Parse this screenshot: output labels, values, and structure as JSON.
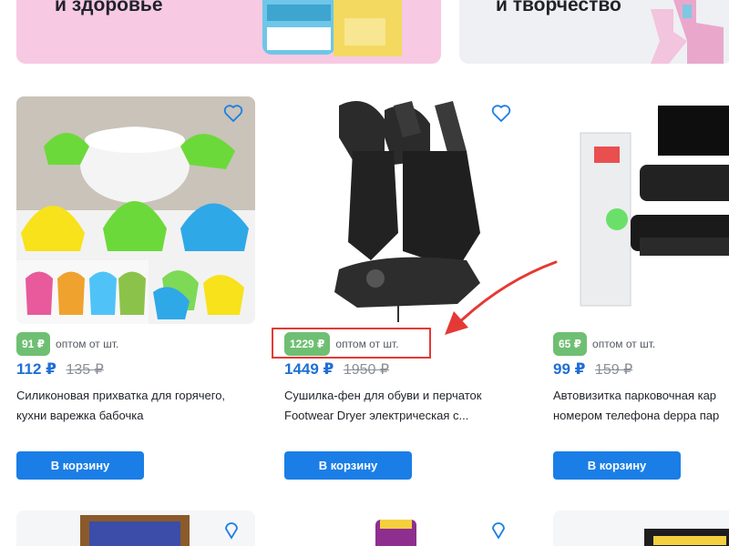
{
  "banners": [
    {
      "title": "и здоровье"
    },
    {
      "title": "и творчество"
    }
  ],
  "products": [
    {
      "opt_badge": "91 ₽",
      "opt_text": "оптом от шт.",
      "price": "112 ₽",
      "old_price": "135 ₽",
      "title": "Силиконовая прихватка для горячего, кухни варежка бабочка",
      "cart_label": "В корзину"
    },
    {
      "opt_badge": "1229 ₽",
      "opt_text": "оптом от шт.",
      "price": "1449 ₽",
      "old_price": "1950 ₽",
      "title": "Сушилка-фен для обуви и перчаток Footwear Dryer электрическая с...",
      "cart_label": "В корзину"
    },
    {
      "opt_badge": "65 ₽",
      "opt_text": "оптом от шт.",
      "price": "99 ₽",
      "old_price": "159 ₽",
      "title": "Автовизитка парковочная кар",
      "title_line2": "номером телефона deppa пар",
      "cart_label": "В корзину"
    }
  ],
  "colors": {
    "price": "#1f6fd6",
    "opt_badge": "#6fbf73",
    "cart_button": "#1a7ee6",
    "annotation": "#e53935"
  },
  "icons": {
    "favorite": "heart-outline-icon"
  }
}
